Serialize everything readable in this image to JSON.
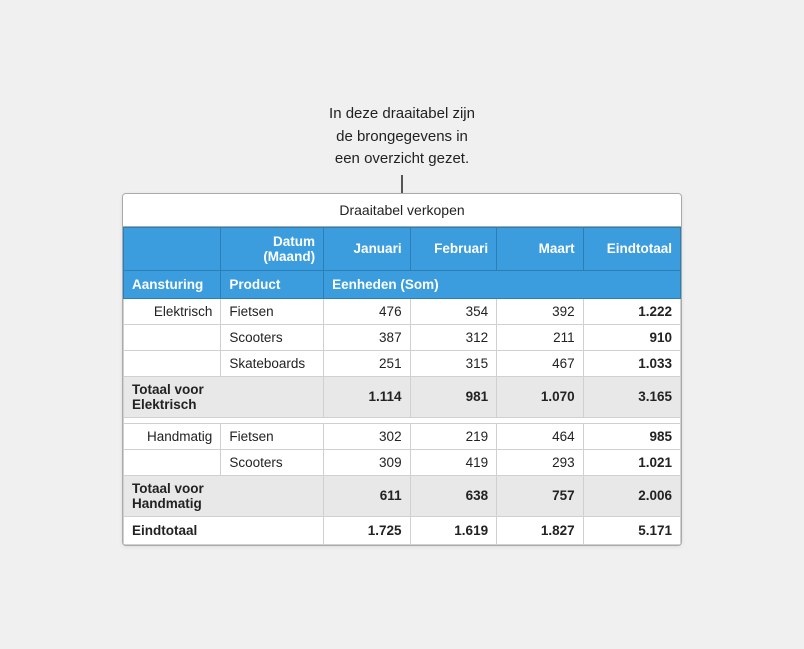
{
  "callout": {
    "line1": "In deze draaitabel zijn",
    "line2": "de brongegevens in",
    "line3": "een overzicht gezet."
  },
  "table": {
    "title": "Draaitabel verkopen",
    "header1": {
      "datum_maand": "Datum\n(Maand)",
      "januari": "Januari",
      "februari": "Februari",
      "maart": "Maart",
      "eindtotaal": "Eindtotaal"
    },
    "header2": {
      "aansturing": "Aansturing",
      "product": "Product",
      "eenheden": "Eenheden (Som)"
    },
    "rows": [
      {
        "aansturing": "Elektrisch",
        "product": "Fietsen",
        "jan": "476",
        "feb": "354",
        "maart": "392",
        "eindtotaal": "1.222"
      },
      {
        "aansturing": "",
        "product": "Scooters",
        "jan": "387",
        "feb": "312",
        "maart": "211",
        "eindtotaal": "910"
      },
      {
        "aansturing": "",
        "product": "Skateboards",
        "jan": "251",
        "feb": "315",
        "maart": "467",
        "eindtotaal": "1.033"
      }
    ],
    "subtotal_elektrisch": {
      "label": "Totaal voor\nElektrisch",
      "jan": "1.114",
      "feb": "981",
      "maart": "1.070",
      "eindtotaal": "3.165"
    },
    "rows2": [
      {
        "aansturing": "Handmatig",
        "product": "Fietsen",
        "jan": "302",
        "feb": "219",
        "maart": "464",
        "eindtotaal": "985"
      },
      {
        "aansturing": "",
        "product": "Scooters",
        "jan": "309",
        "feb": "419",
        "maart": "293",
        "eindtotaal": "1.021"
      }
    ],
    "subtotal_handmatig": {
      "label": "Totaal voor\nHandmatig",
      "jan": "611",
      "feb": "638",
      "maart": "757",
      "eindtotaal": "2.006"
    },
    "grand_total": {
      "label": "Eindtotaal",
      "jan": "1.725",
      "feb": "1.619",
      "maart": "1.827",
      "eindtotaal": "5.171"
    }
  }
}
